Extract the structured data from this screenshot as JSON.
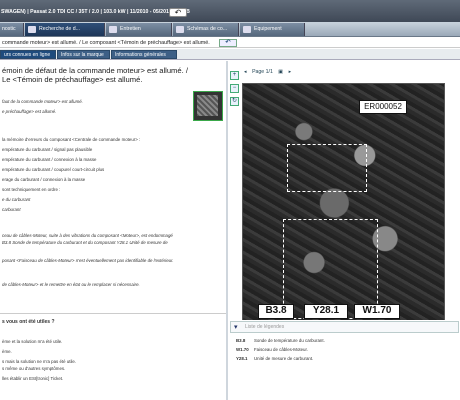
{
  "header": {
    "top_label": "SWAGEN",
    "vehicle_line": "SWAGEN) | Passat 2.0 TDI CC / 35T / 2.0 | 103.0 kW | 11/2010 - 05/2012 | CFFB",
    "back_icon": "back-arrow-icon"
  },
  "tabs": [
    {
      "label": "nostic",
      "icon": "diagnostic-icon"
    },
    {
      "label": "Recherche de d...",
      "icon": "search-icon"
    },
    {
      "label": "Entretien",
      "icon": "wrench-icon"
    },
    {
      "label": "Schémas de co...",
      "icon": "schematic-icon"
    },
    {
      "label": "Equipement",
      "icon": "equipment-icon"
    }
  ],
  "breadcrumb": {
    "text": "commande moteur> est allumé. / Le composant <Témoin de préchauffage> est allumé.",
    "back_icon": "back-arrow-icon"
  },
  "subtabs": [
    "urs connues en ligne",
    "Infos sur la marque",
    "Informations générales"
  ],
  "article": {
    "heading": "émoin de défaut de la commande moteur> est allumé. / Le  <Témoin de préchauffage> est allumé.",
    "lines": [
      {
        "text": "faut de la commande moteur> est allumé.",
        "style": "i"
      },
      {
        "text": "e préchauffage> est allumé.",
        "style": "i"
      },
      {
        "text": "la mémoire d'erreurs du composant <Centrale de commande moteur> :",
        "style": ""
      },
      {
        "text": "empérature du carburant / signal pas plausible",
        "style": ""
      },
      {
        "text": "empérature du carburant / connexion à la masse",
        "style": ""
      },
      {
        "text": "empérature du carburant / coupure/ court-circuit plus",
        "style": ""
      },
      {
        "text": "erage du carburant / connexion à la masse",
        "style": ""
      },
      {
        "text": "sont techniquement en ordre :",
        "style": ""
      },
      {
        "text": "e du carburant",
        "style": "i"
      },
      {
        "text": "carburant",
        "style": "i"
      },
      {
        "text": "ceau de câbles-Moteur, suite à des vibrations du composant <Moteur>, est endommagé",
        "style": "i"
      },
      {
        "text": "B3.8 Sonde de température du carburant et du composant Y28.1 Unité de mesure de",
        "style": "i"
      },
      {
        "text": "posant <Faisceau de câbles-Moteur> n'est éventuellement pas identifiable de l'extérieur.",
        "style": "i"
      },
      {
        "text": "de câbles-Moteur> et le remettre en état ou le remplacer si nécessaire.",
        "style": "i"
      },
      {
        "text": "s vous ont été utiles ?",
        "style": "b"
      },
      {
        "text": "ème et la solution m'a été utile.",
        "style": ""
      },
      {
        "text": "ème.",
        "style": ""
      },
      {
        "text": "s mais la solution ne m'a pas été utile.",
        "style": ""
      },
      {
        "text": "s même ou d'autres symptômes.",
        "style": ""
      },
      {
        "text": "lles établir un ESI[tronic] Ticket.",
        "style": ""
      }
    ]
  },
  "viewer": {
    "page": "Page 1/1",
    "image_code": "ER000052",
    "labels": [
      "B3.8",
      "Y28.1",
      "W1.70"
    ],
    "legend_placeholder": "Liste de légendes",
    "legend": [
      {
        "code": "B3.8",
        "text": "Sonde de température du carburant."
      },
      {
        "code": "W1.70",
        "text": "Faisceau de câbles-Moteur."
      },
      {
        "code": "Y28.1",
        "text": "Unité de mesure de carburant."
      }
    ],
    "tools": [
      "zoom-in-icon",
      "zoom-out-icon",
      "rotate-icon"
    ]
  }
}
